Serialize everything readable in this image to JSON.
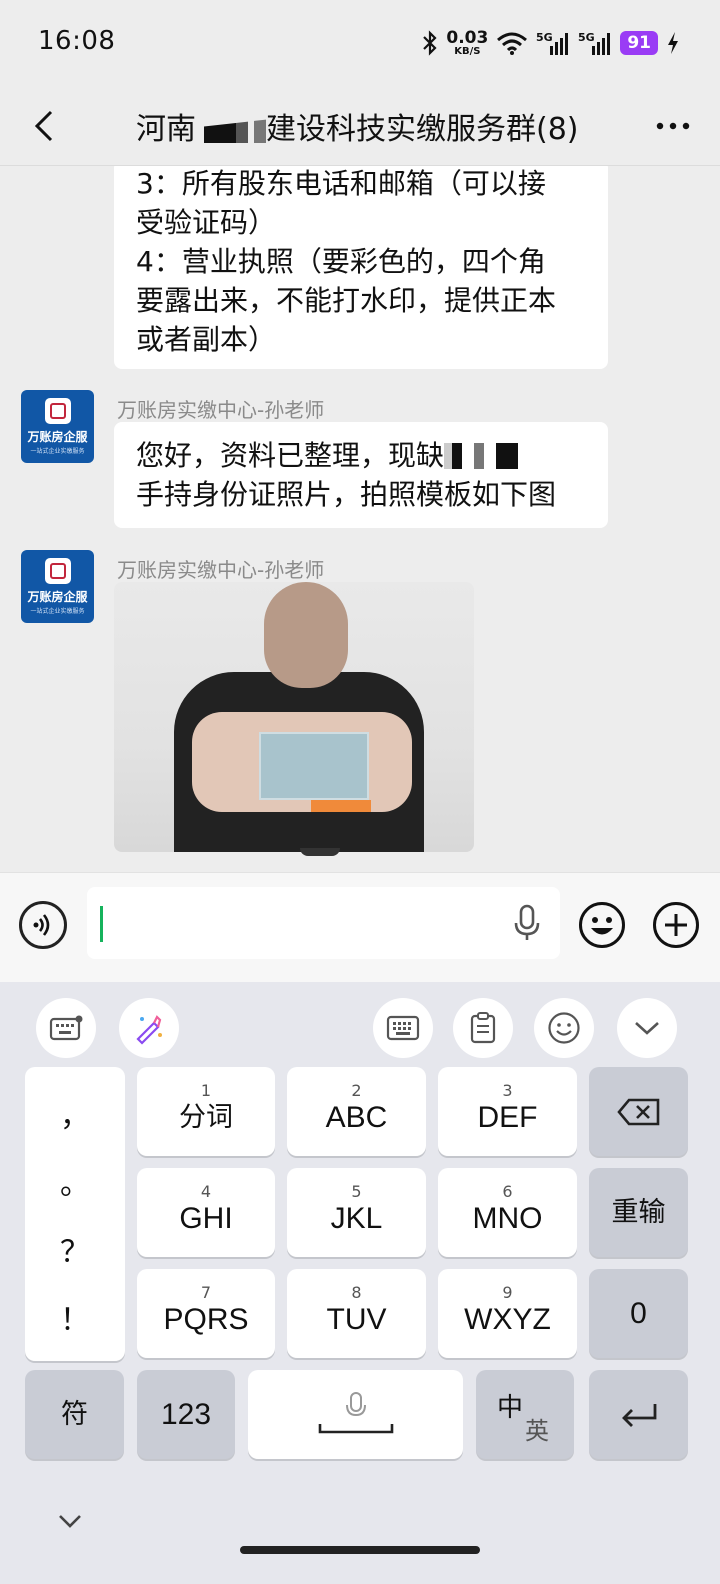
{
  "status_bar": {
    "time": "16:08",
    "net_speed_value": "0.03",
    "net_speed_unit": "KB/S",
    "signal1": "5G",
    "signal2": "5G",
    "battery": "91",
    "icons": [
      "bluetooth-icon",
      "wifi-icon",
      "signal-icon",
      "charging-icon"
    ]
  },
  "header": {
    "title_before": "河南",
    "title_after": "建设科技实缴服务群(8)",
    "back_icon": "chevron-left-icon",
    "more_icon": "more-dots-icon"
  },
  "messages": [
    {
      "text_lines": [
        "3：所有股东电话和邮箱（可以接",
        "受验证码）",
        "4：营业执照（要彩色的，四个角",
        "要露出来，不能打水印，提供正本",
        "或者副本）"
      ]
    },
    {
      "sender": "万账房实缴中心-孙老师",
      "line1": "您好，资料已整理，现缺",
      "line2": "手持身份证照片，拍照模板如下图"
    },
    {
      "sender": "万账房实缴中心-孙老师",
      "type": "image"
    }
  ],
  "avatar": {
    "name": "万账房企服",
    "sub": "一站式企业实缴服务"
  },
  "input_bar": {
    "value": ""
  },
  "keyboard": {
    "tools": [
      "keyboard-settings-icon",
      "magic-pen-icon",
      "keyboard-icon",
      "clipboard-icon",
      "emoji-icon",
      "chevron-down-icon"
    ],
    "punct": [
      "，",
      "。",
      "？",
      "！"
    ],
    "keys": [
      {
        "num": "1",
        "label": "分词"
      },
      {
        "num": "2",
        "label": "ABC"
      },
      {
        "num": "3",
        "label": "DEF"
      },
      {
        "num": "4",
        "label": "GHI"
      },
      {
        "num": "5",
        "label": "JKL"
      },
      {
        "num": "6",
        "label": "MNO"
      },
      {
        "num": "7",
        "label": "PQRS"
      },
      {
        "num": "8",
        "label": "TUV"
      },
      {
        "num": "9",
        "label": "WXYZ"
      }
    ],
    "reinput": "重输",
    "zero": "0",
    "symbols": "符",
    "numbers": "123",
    "lang_main": "中",
    "lang_alt": "英"
  }
}
